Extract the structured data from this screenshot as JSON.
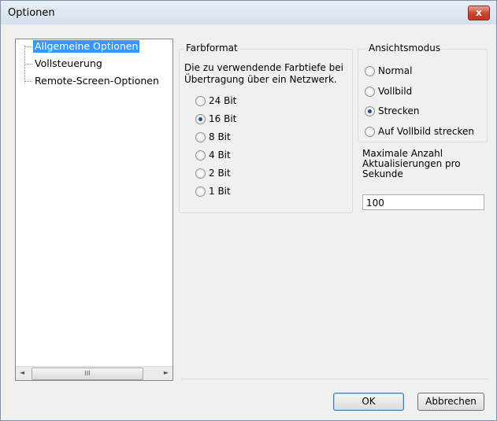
{
  "window": {
    "title": "Optionen",
    "close_glyph": "x"
  },
  "tree": {
    "items": [
      "Allgemeine Optionen",
      "Vollsteuerung",
      "Remote-Screen-Optionen"
    ],
    "scroll_left": "◄",
    "scroll_thumb": "III",
    "scroll_right": "►"
  },
  "farbformat": {
    "label": "Farbformat",
    "description_line1": "Die zu verwendende Farbtiefe bei",
    "description_line2": "Übertragung über ein Netzwerk.",
    "options": [
      "24 Bit",
      "16 Bit",
      "8 Bit",
      "4 Bit",
      "2 Bit",
      "1 Bit"
    ],
    "selected": "16 Bit"
  },
  "ansichtsmodus": {
    "label": "Ansichtsmodus",
    "options": [
      "Normal",
      "Vollbild",
      "Strecken",
      "Auf Vollbild strecken"
    ],
    "selected": "Strecken"
  },
  "updates": {
    "label_line1": "Maximale Anzahl",
    "label_line2": "Aktualisierungen pro",
    "label_line3": "Sekunde",
    "value": "100"
  },
  "buttons": {
    "ok": "OK",
    "cancel": "Abbrechen"
  }
}
